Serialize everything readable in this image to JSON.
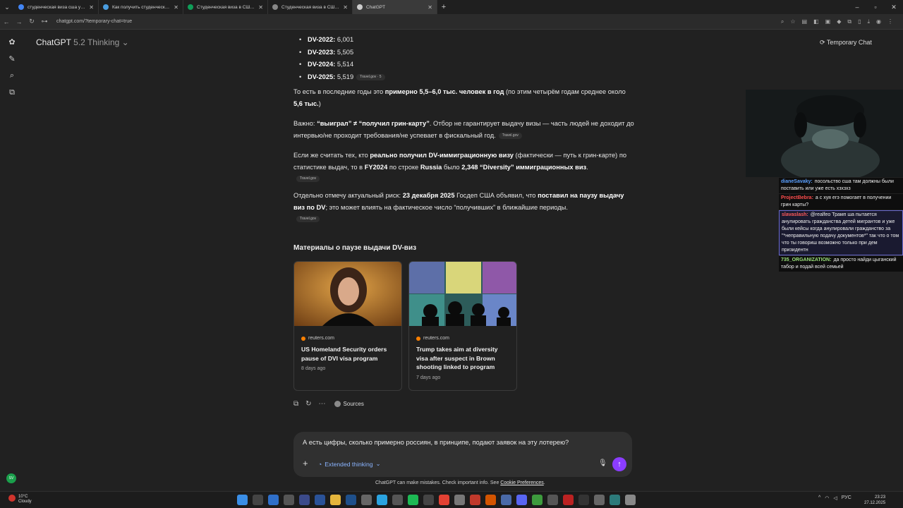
{
  "browser": {
    "tabs": [
      {
        "title": "студенческая виза сша учитс",
        "active": false,
        "color": "#4285f4"
      },
      {
        "title": "Как получить студенческую в",
        "active": false,
        "color": "#4a9de0"
      },
      {
        "title": "Студенческая виза в США - к",
        "active": false,
        "color": "#0f9d58"
      },
      {
        "title": "Студенческая виза в США: са",
        "active": false,
        "color": "#888888"
      },
      {
        "title": "ChatGPT",
        "active": true,
        "color": "#cccccc"
      }
    ],
    "url": "chatgpt.com/?temporary-chat=true"
  },
  "header": {
    "model_name": "ChatGPT",
    "model_version": "5.2 Thinking",
    "temporary_chat": "Temporary Chat"
  },
  "content": {
    "bullets": [
      {
        "label": "DV-2022:",
        "value": " 6,001"
      },
      {
        "label": "DV-2023:",
        "value": " 5,505"
      },
      {
        "label": "DV-2024:",
        "value": " 5,514"
      },
      {
        "label": "DV-2025:",
        "value": " 5,519"
      }
    ],
    "bullet_source": "Travel.gov · 5",
    "p1_a": "То есть в последние годы это ",
    "p1_b": "примерно 5,5–6,0 тыс. человек в год",
    "p1_c": " (по этим четырём годам среднее около ",
    "p1_d": "5,6 тыс.",
    "p1_e": ")",
    "p2_a": "Важно: ",
    "p2_b": "“выиграл” ≠ “получил грин-карту”",
    "p2_c": ". Отбор не гарантирует выдачу визы — часть людей не доходит до интервью/не проходит требования/не успевает в фискальный год.",
    "p2_source": "Travel.gov",
    "p3_a": "Если же считать тех, кто ",
    "p3_b": "реально получил DV-иммиграционную визу",
    "p3_c": " (фактически — путь к грин-карте) по статистике выдач, то в ",
    "p3_d": "FY2024",
    "p3_e": " по строке ",
    "p3_f": "Russia",
    "p3_g": " было ",
    "p3_h": "2,348 “Diversity” иммиграционных виз",
    "p3_i": ".",
    "p3_source": "Travel.gov",
    "p4_a": "Отдельно отмечу актуальный риск: ",
    "p4_b": "23 декабря 2025",
    "p4_c": " Госдеп США объявил, что ",
    "p4_d": "поставил на паузу выдачу виз по DV",
    "p4_e": "; это может влиять на фактическое число “получивших” в ближайшие периоды.",
    "p4_source": "Travel.gov"
  },
  "materials": {
    "title": "Материалы о паузе выдачи DV-виз",
    "cards": [
      {
        "source": "reuters.com",
        "headline": "US Homeland Security orders pause of DVI visa program",
        "age": "8 days ago"
      },
      {
        "source": "reuters.com",
        "headline": "Trump takes aim at diversity visa after suspect in Brown shooting linked to program",
        "age": "7 days ago"
      }
    ]
  },
  "actions": {
    "sources_label": "Sources"
  },
  "composer": {
    "text": "А есть цифры, сколько примерно россиян, в принципе, подают заявок на эту лотерею?",
    "mode": "Extended thinking"
  },
  "disclaimer": {
    "text": "ChatGPT can make mistakes. Check important info. See ",
    "link": "Cookie Preferences",
    "end": "."
  },
  "stream_chat": [
    {
      "user": "dianeSavaky:",
      "color": "#5aa0ff",
      "text": "посольство сша там должны были поставить или уже есть хзхзхз",
      "highlight": false
    },
    {
      "user": "ProjectBebra:",
      "color": "#ff4d4d",
      "text": "а с хуя егэ помогает в получении грин карты?",
      "highlight": false
    },
    {
      "user": "slavaslash:",
      "color": "#ff5a5a",
      "text": "@realfeo Трамп ша пытается анулировать гражданства детей мигрантов и уже были кейсы когда анулировали гражданство за \"*неправильную подачу документов*\" так что о том что ты говориш возможно только при дем призидентн",
      "highlight": true
    },
    {
      "user": "735_ORGANIZATION:",
      "color": "#9be27a",
      "text": "да просто найди цыганский табор и подай всей семьей",
      "highlight": false
    }
  ],
  "taskbar": {
    "weather_temp": "10°C",
    "weather_desc": "Cloudy",
    "lang": "РУС",
    "time": "23:23",
    "date": "27.12.2025"
  },
  "sidebar": {
    "avatar_initials": "SV"
  }
}
